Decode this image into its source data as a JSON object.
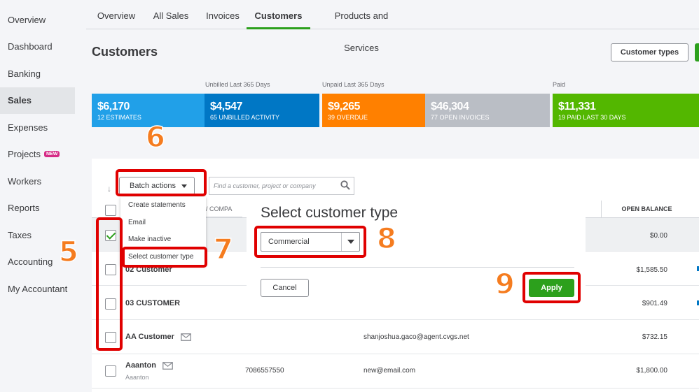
{
  "leftnav": {
    "items": [
      {
        "label": "Overview",
        "active": false
      },
      {
        "label": "Dashboard",
        "active": false
      },
      {
        "label": "Banking",
        "active": false
      },
      {
        "label": "Sales",
        "active": true
      },
      {
        "label": "Expenses",
        "active": false
      },
      {
        "label": "Projects",
        "active": false,
        "badge": "NEW"
      },
      {
        "label": "Workers",
        "active": false
      },
      {
        "label": "Reports",
        "active": false
      },
      {
        "label": "Taxes",
        "active": false
      },
      {
        "label": "Accounting",
        "active": false
      },
      {
        "label": "My Accountant",
        "active": false
      }
    ]
  },
  "tabs": [
    {
      "label": "Overview"
    },
    {
      "label": "All Sales"
    },
    {
      "label": "Invoices"
    },
    {
      "label": "Customers",
      "active": true
    },
    {
      "label": "Products and Services"
    }
  ],
  "page": {
    "title": "Customers",
    "customer_types_button": "Customer types"
  },
  "money_bar": {
    "labels": {
      "unbilled": "Unbilled Last 365 Days",
      "unpaid": "Unpaid Last 365 Days",
      "paid": "Paid"
    },
    "segments": [
      {
        "amount": "$6,170",
        "label": "12 ESTIMATES",
        "color": "#21a0e8"
      },
      {
        "amount": "$4,547",
        "label": "65 UNBILLED ACTIVITY",
        "color": "#0077c5"
      },
      {
        "amount": "$9,265",
        "label": "39 OVERDUE",
        "color": "#ff8000"
      },
      {
        "amount": "$46,304",
        "label": "77 OPEN INVOICES",
        "color": "#babec5"
      },
      {
        "amount": "$11,331",
        "label": "19 PAID LAST 30 DAYS",
        "color": "#53b700"
      }
    ]
  },
  "toolbar": {
    "batch_label": "Batch actions",
    "search_placeholder": "Find a customer, project or company"
  },
  "batch_menu": {
    "items": [
      "Create statements",
      "Email",
      "Make inactive",
      "Select customer type"
    ]
  },
  "table": {
    "col_company": "/ COMPA",
    "col_open_balance": "OPEN BALANCE",
    "rows": [
      {
        "name": "",
        "subname": "",
        "phone": "",
        "email": "",
        "balance": "$0.00",
        "checked": true
      },
      {
        "name": "02 Customer",
        "subname": "",
        "phone": "",
        "email": "",
        "balance": "$1,585.50",
        "checked": false
      },
      {
        "name": "03 CUSTOMER",
        "subname": "",
        "phone": "",
        "email": "",
        "balance": "$901.49",
        "checked": false
      },
      {
        "name": "AA Customer",
        "subname": "",
        "phone": "",
        "email": "shanjoshua.gaco@agent.cvgs.net",
        "balance": "$732.15",
        "checked": false,
        "mail": true
      },
      {
        "name": "Aaanton",
        "subname": "Aaanton",
        "phone": "7086557550",
        "email": "new@email.com",
        "balance": "$1,800.00",
        "checked": false,
        "mail": true
      }
    ]
  },
  "dialog": {
    "title": "Select customer type",
    "select_value": "Commercial",
    "cancel_label": "Cancel",
    "apply_label": "Apply"
  },
  "annotations": {
    "steps": [
      "5",
      "6",
      "7",
      "8",
      "9"
    ],
    "color": "#e00000",
    "number_color": "#f57c1f"
  }
}
